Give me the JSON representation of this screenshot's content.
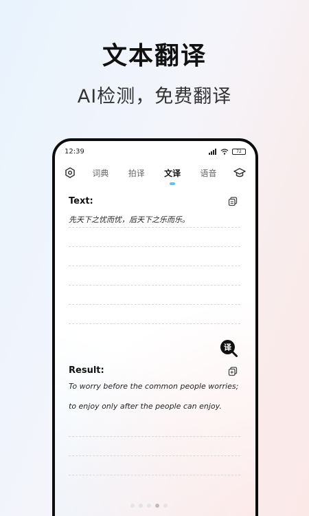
{
  "promo": {
    "title": "文本翻译",
    "subtitle": "AI检测，免费翻译"
  },
  "status_bar": {
    "time": "12:39",
    "battery": "72"
  },
  "tabs": [
    {
      "label": "词典",
      "active": false
    },
    {
      "label": "拍译",
      "active": false
    },
    {
      "label": "文译",
      "active": true
    },
    {
      "label": "语音",
      "active": false
    }
  ],
  "source": {
    "label": "Text:",
    "content": "先天下之忧而忧，后天下之乐而乐。"
  },
  "translate_button": {
    "glyph": "译"
  },
  "result": {
    "label": "Result:",
    "content": "To worry before the common people worries; to enjoy only after the people can enjoy."
  },
  "colors": {
    "accent": "#5cc4ef",
    "dark": "#111111"
  },
  "icons": {
    "settings": "hexagon-gear-icon",
    "learn": "graduation-cap-icon",
    "copy_source": "copy-icon",
    "copy_result": "copy-plus-icon"
  }
}
